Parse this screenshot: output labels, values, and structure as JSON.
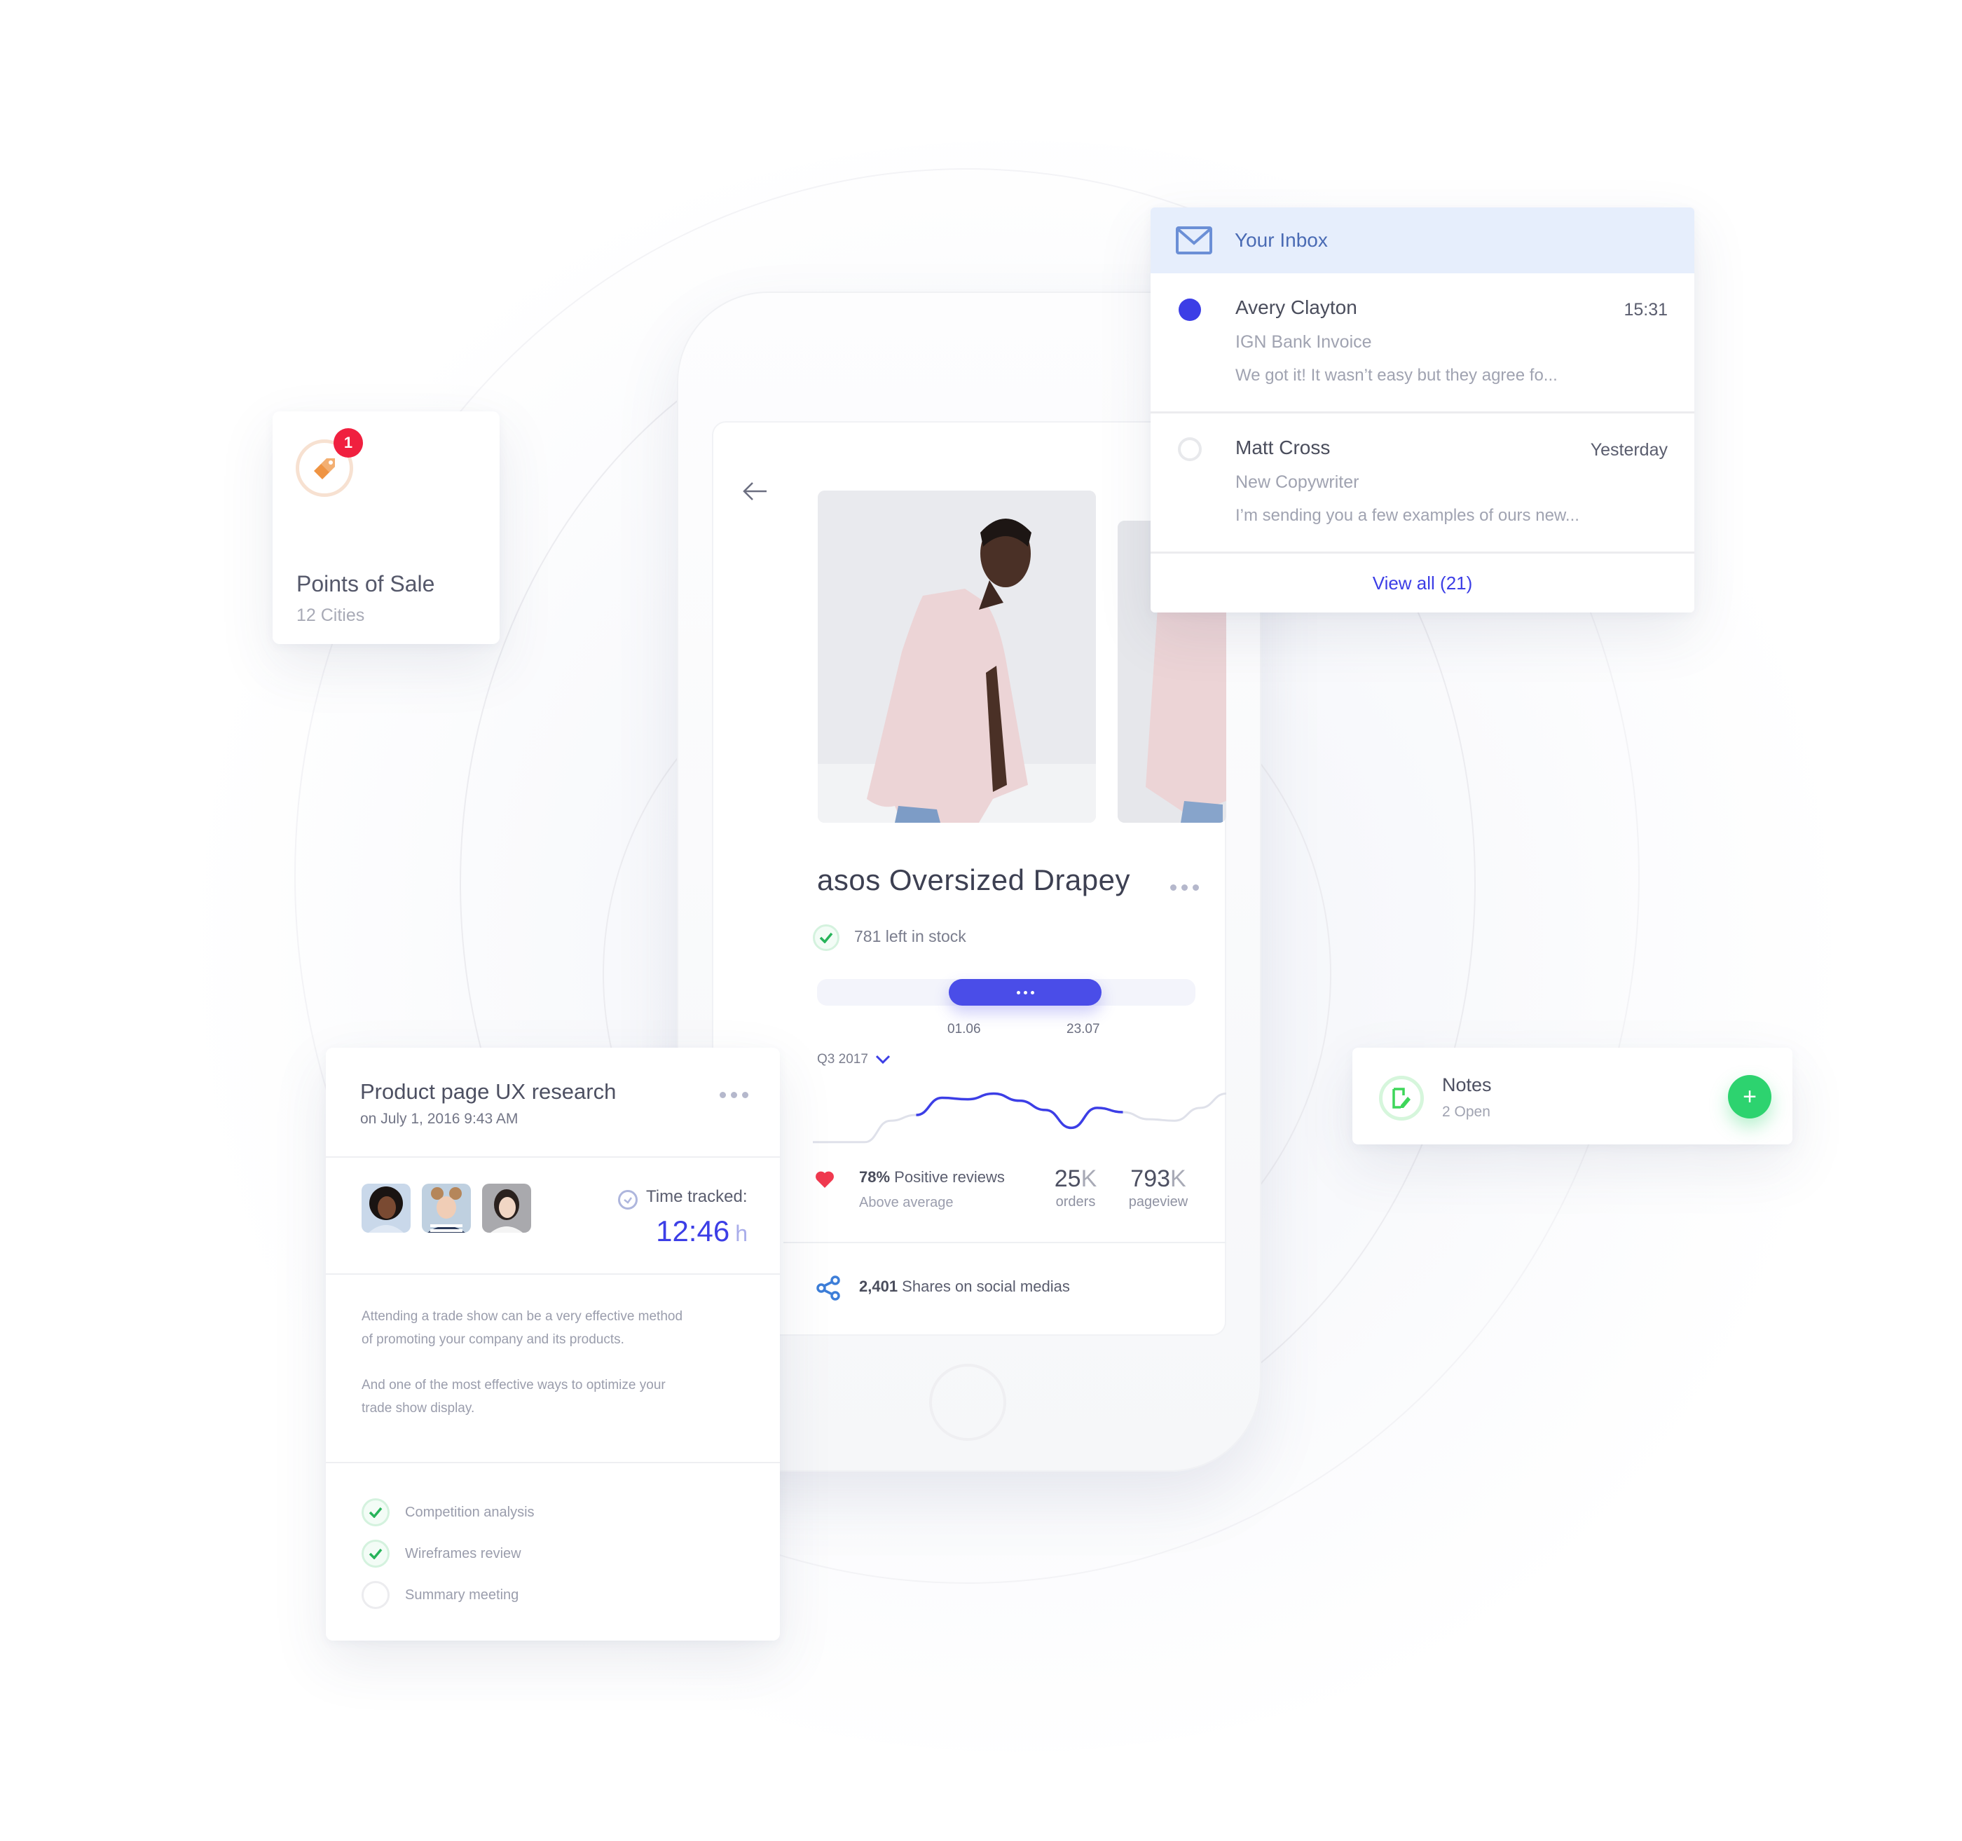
{
  "inbox": {
    "title": "Your Inbox",
    "icon": "envelope-icon",
    "messages": [
      {
        "sender": "Avery Clayton",
        "time": "15:31",
        "subject": "IGN Bank Invoice",
        "preview": "We got it! It wasn’t easy but they agree fo...",
        "unread": true
      },
      {
        "sender": "Matt Cross",
        "time": "Yesterday",
        "subject": "New Copywriter",
        "preview": "I’m sending you a few examples of ours new...",
        "unread": false
      }
    ],
    "view_all_label": "View all (21)"
  },
  "points_of_sale": {
    "title": "Points of Sale",
    "subtitle": "12 Cities",
    "badge_count": "1",
    "icon": "price-tag-icon"
  },
  "product": {
    "title": "asos Oversized Drapey",
    "stock_text": "781 left in stock",
    "range": {
      "start_label": "01.06",
      "end_label": "23.07",
      "selected_start_fraction": 0.35,
      "selected_end_fraction": 0.75
    },
    "period_label": "Q3 2017",
    "reviews": {
      "percent": "78%",
      "label": " Positive reviews",
      "sub": "Above average"
    },
    "stats": [
      {
        "value": "25",
        "unit": "K",
        "label": "orders"
      },
      {
        "value": "793",
        "unit": "K",
        "label": "pageview"
      }
    ],
    "shares": {
      "count": "2,401",
      "label": " Shares on social medias"
    }
  },
  "chart_data": {
    "type": "line",
    "title": "",
    "xlabel": "",
    "ylabel": "",
    "x": [
      0,
      1,
      2,
      3,
      4,
      5,
      6,
      7,
      8,
      9,
      10,
      11,
      12,
      13,
      14,
      15,
      16
    ],
    "values": [
      10,
      10,
      10,
      40,
      48,
      72,
      70,
      78,
      68,
      55,
      30,
      58,
      52,
      42,
      40,
      58,
      78
    ],
    "highlight_range": [
      4,
      12
    ],
    "ylim": [
      0,
      100
    ],
    "grid": false,
    "colors": {
      "base": "#dfe1ea",
      "highlight": "#3c3ee6"
    }
  },
  "ux_card": {
    "title": "Product page UX research",
    "date": "on July 1, 2016 9:43 AM",
    "avatars": [
      "avatar-1",
      "avatar-2",
      "avatar-3"
    ],
    "time_tracked_label": "Time tracked:",
    "time_tracked_value": "12:46",
    "time_tracked_unit": "h",
    "body": [
      "Attending a trade show can be a very effective method of promoting your company and its products.",
      "And one of the most effective ways to optimize your trade show display."
    ],
    "tasks": [
      {
        "label": "Competition analysis",
        "done": true
      },
      {
        "label": "Wireframes review",
        "done": true
      },
      {
        "label": "Summary meeting",
        "done": false
      }
    ]
  },
  "notes": {
    "title": "Notes",
    "subtitle": "2 Open",
    "add_label": "+"
  },
  "colors": {
    "accent": "#3c3ee6",
    "success": "#2dd36f",
    "danger": "#f0203f",
    "tag_orange": "#ef9443",
    "inbox_header_bg": "#e6eefc"
  }
}
